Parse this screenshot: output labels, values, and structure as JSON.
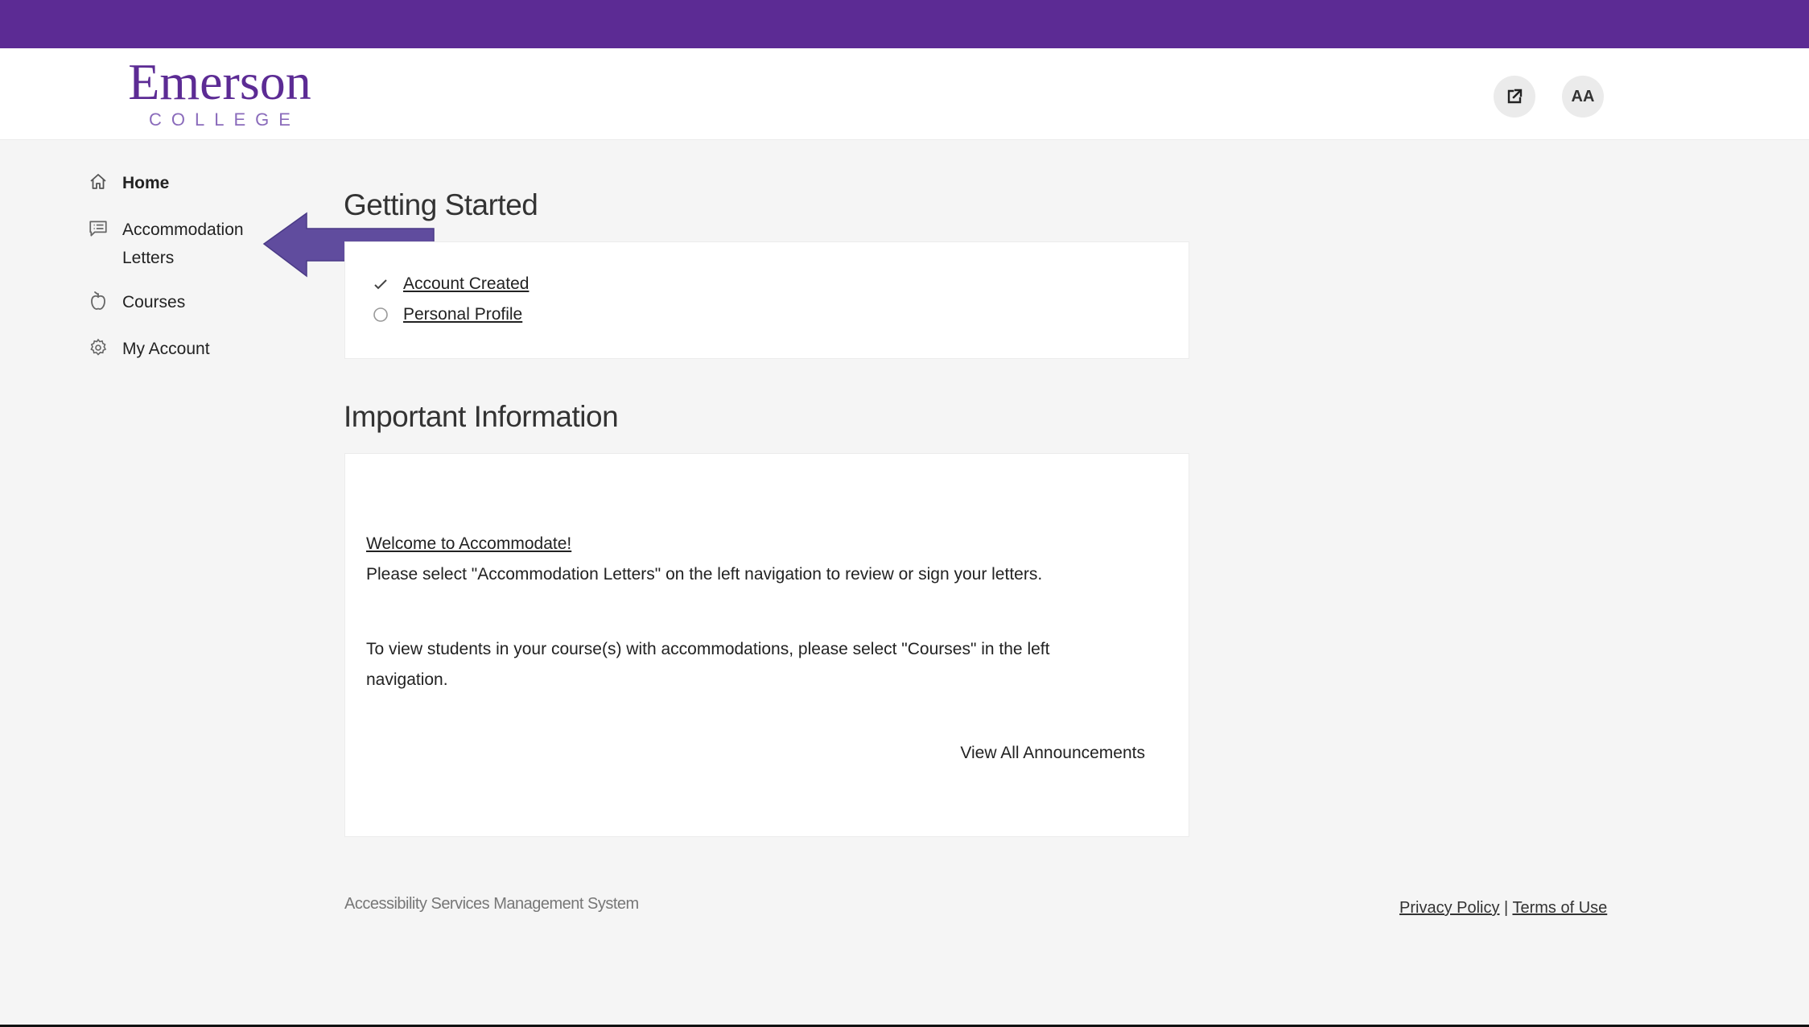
{
  "brand": {
    "logo_word": "Emerson",
    "logo_sub": "COLLEGE",
    "primary_color": "#5c2b94",
    "arrow_color": "#604c9e"
  },
  "header": {
    "external_link_icon": "external-link-icon",
    "text_size_label": "AA"
  },
  "sidebar": {
    "items": [
      {
        "label": "Home",
        "icon": "home-icon",
        "active": true
      },
      {
        "label": "Accommodation Letters",
        "icon": "message-list-icon",
        "active": false
      },
      {
        "label": "Courses",
        "icon": "apple-icon",
        "active": false
      },
      {
        "label": "My Account",
        "icon": "gear-icon",
        "active": false
      }
    ]
  },
  "getting_started": {
    "title": "Getting Started",
    "steps": [
      {
        "label": "Account Created",
        "status": "complete",
        "icon": "check-icon"
      },
      {
        "label": "Personal Profile",
        "status": "incomplete",
        "icon": "circle-icon"
      }
    ]
  },
  "important_info": {
    "title": "Important Information",
    "welcome_link": "Welcome to Accommodate!",
    "paragraph1": "Please select \"Accommodation Letters\" on the left navigation to review or sign your letters.",
    "paragraph2_line1": "To view students in your course(s) with accommodations, please select \"Courses\" in the left",
    "paragraph2_line2": "navigation.",
    "view_all_label": "View All Announcements"
  },
  "footer": {
    "system_name": "Accessibility Services Management System",
    "privacy_label": "Privacy Policy",
    "separator": "|",
    "terms_label": "Terms of Use"
  }
}
